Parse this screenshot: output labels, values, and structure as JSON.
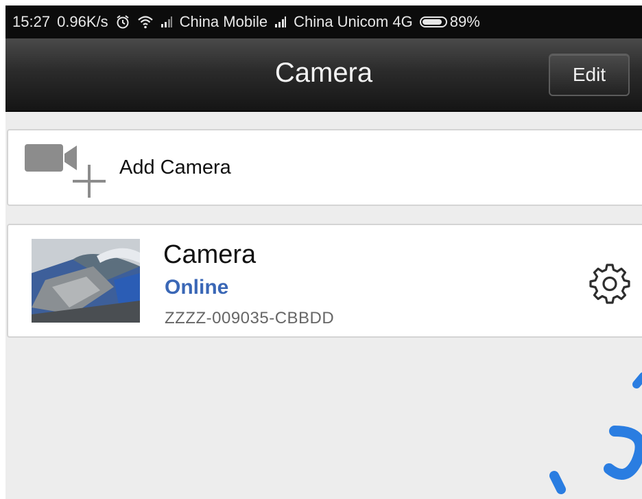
{
  "status_bar": {
    "time": "15:27",
    "network_speed": "0.96K/s",
    "carrier_1": "China Mobile",
    "carrier_2": "China Unicom 4G",
    "battery_percent": "89%",
    "battery_level": 0.89,
    "icons": [
      "alarm-icon",
      "wifi-icon",
      "signal-icon",
      "battery-icon"
    ]
  },
  "header": {
    "title": "Camera",
    "edit_label": "Edit"
  },
  "add_camera": {
    "label": "Add Camera",
    "icon": "add-video-camera-icon"
  },
  "cameras": [
    {
      "name": "Camera",
      "status": "Online",
      "device_id": "ZZZZ-009035-CBBDD",
      "settings_icon": "gear-icon"
    }
  ],
  "colors": {
    "status_online": "#3a67b6",
    "nav_bar": "#2b2b2b",
    "background": "#ededed"
  }
}
